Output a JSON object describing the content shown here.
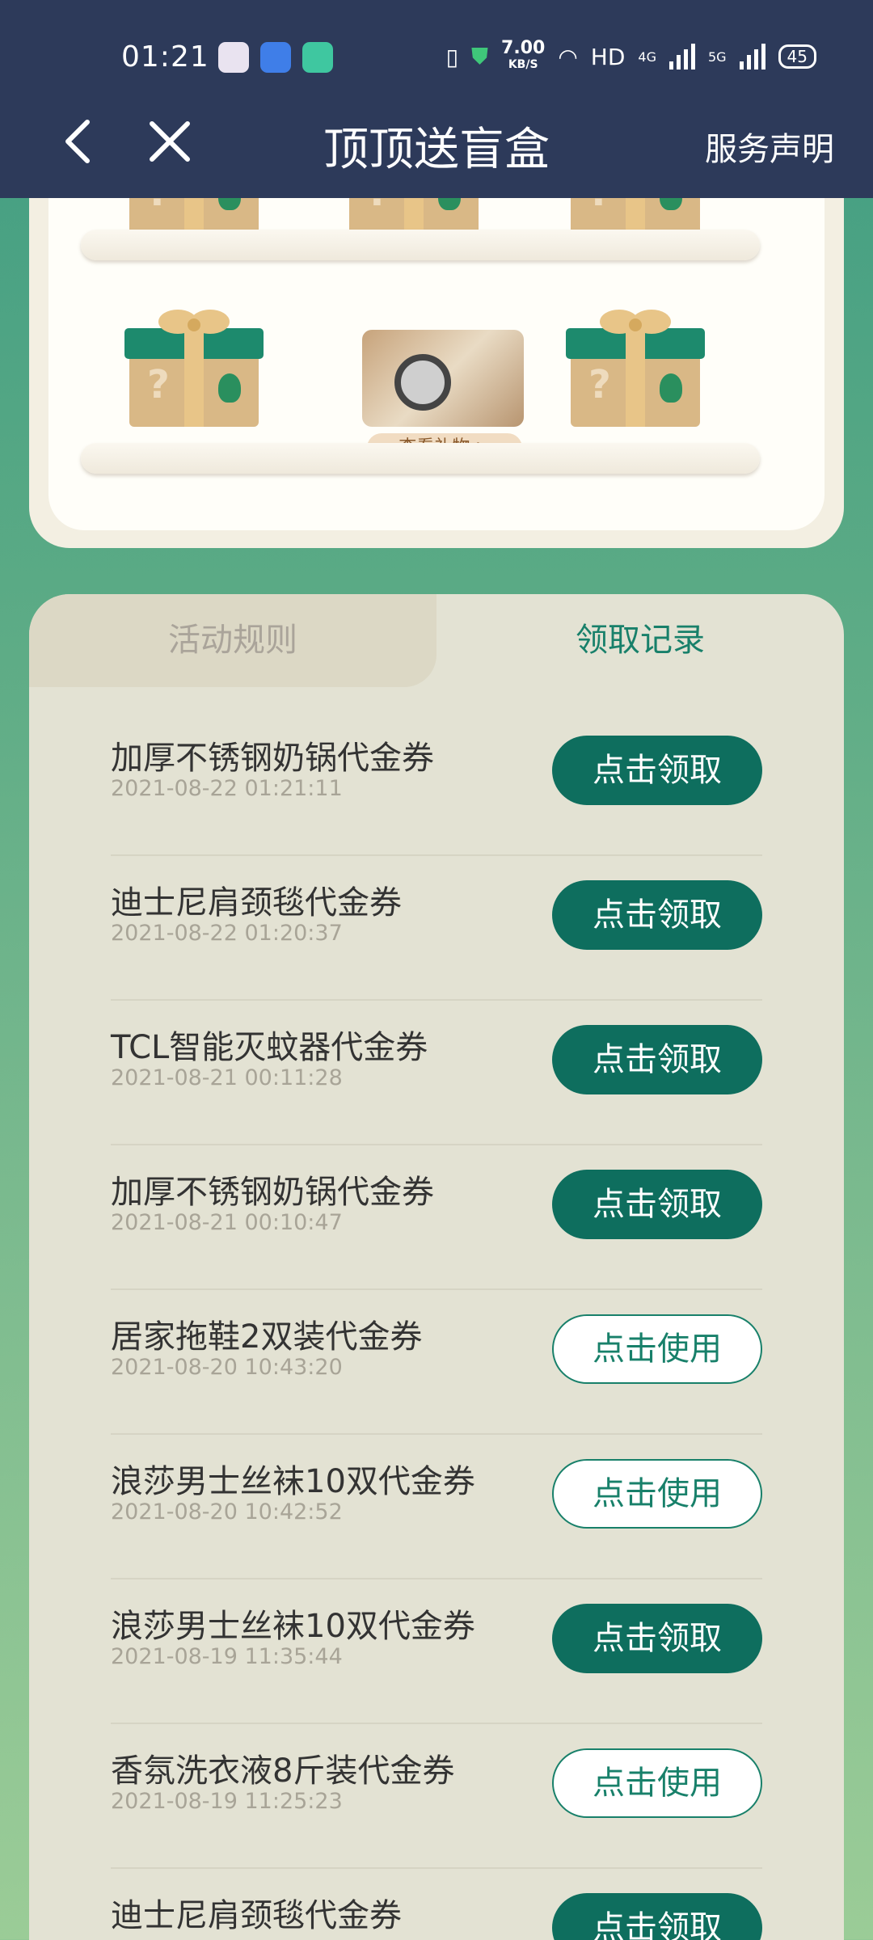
{
  "status_bar": {
    "time": "01:21",
    "net_speed_value": "7.00",
    "net_speed_unit": "KB/S",
    "hd_label": "HD",
    "net1": "4G",
    "net2": "5G",
    "battery": "45"
  },
  "nav": {
    "title": "顶顶送盲盒",
    "service_label": "服务声明"
  },
  "gift_area": {
    "view_gift_label": "查看礼物 >",
    "box_mark": "?"
  },
  "tabs": [
    {
      "label": "活动规则",
      "active": false
    },
    {
      "label": "领取记录",
      "active": true
    }
  ],
  "records": [
    {
      "name": "加厚不锈钢奶锅代金券",
      "date": "2021-08-22 01:21:11",
      "button": "点击领取",
      "type": "claim"
    },
    {
      "name": "迪士尼肩颈毯代金券",
      "date": "2021-08-22 01:20:37",
      "button": "点击领取",
      "type": "claim"
    },
    {
      "name": "TCL智能灭蚊器代金券",
      "date": "2021-08-21 00:11:28",
      "button": "点击领取",
      "type": "claim"
    },
    {
      "name": "加厚不锈钢奶锅代金券",
      "date": "2021-08-21 00:10:47",
      "button": "点击领取",
      "type": "claim"
    },
    {
      "name": "居家拖鞋2双装代金券",
      "date": "2021-08-20 10:43:20",
      "button": "点击使用",
      "type": "use"
    },
    {
      "name": "浪莎男士丝袜10双代金券",
      "date": "2021-08-20 10:42:52",
      "button": "点击使用",
      "type": "use"
    },
    {
      "name": "浪莎男士丝袜10双代金券",
      "date": "2021-08-19 11:35:44",
      "button": "点击领取",
      "type": "claim"
    },
    {
      "name": "香氛洗衣液8斤装代金券",
      "date": "2021-08-19 11:25:23",
      "button": "点击使用",
      "type": "use"
    },
    {
      "name": "迪士尼肩颈毯代金券",
      "date": "",
      "button": "点击领取",
      "type": "claim"
    }
  ],
  "colors": {
    "header_bg": "#2d3a5a",
    "accent_green": "#0e6e5e",
    "panel_bg": "#e3e2d3"
  }
}
